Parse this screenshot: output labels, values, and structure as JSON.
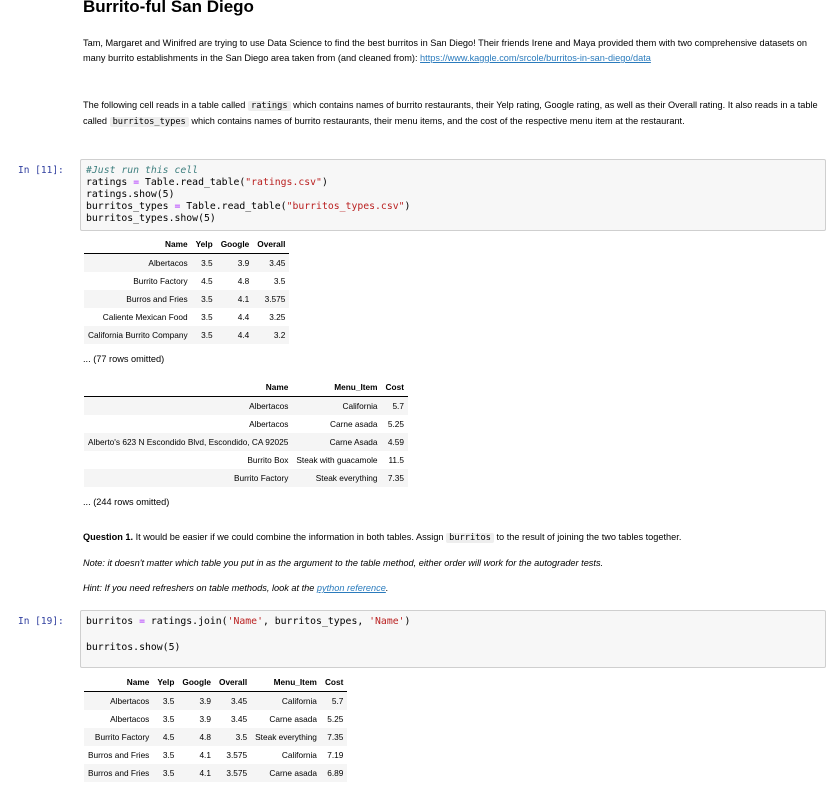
{
  "title": "Burrito-ful San Diego",
  "intro": {
    "text": "Tam, Margaret and Winifred are trying to use Data Science to find the best burritos in San Diego! Their friends Irene and Maya provided them with two comprehensive datasets on many burrito establishments in the San Diego area taken from (and cleaned from): ",
    "link": "https://www.kaggle.com/srcole/burritos-in-san-diego/data"
  },
  "para2": {
    "t1": "The following cell reads in a table called ",
    "c1": "ratings",
    "t2": " which contains names of burrito restaurants, their Yelp rating, Google rating, as well as their Overall rating. It also reads in a table called ",
    "c2": "burritos_types",
    "t3": " which contains names of burrito restaurants, their menu items, and the cost of the respective menu item at the restaurant."
  },
  "cell1": {
    "prompt": "In [11]:",
    "comment": "#Just run this cell",
    "l2a": "ratings ",
    "l2b": " Table.read_table(",
    "l2s": "\"ratings.csv\"",
    "l2c": ")",
    "l3": "ratings.show(5)",
    "l4a": "burritos_types ",
    "l4b": " Table.read_table(",
    "l4s": "\"burritos_types.csv\"",
    "l4c": ")",
    "l5": "burritos_types.show(5)"
  },
  "ratings_table": {
    "headers": [
      "Name",
      "Yelp",
      "Google",
      "Overall"
    ],
    "rows": [
      [
        "Albertacos",
        "3.5",
        "3.9",
        "3.45"
      ],
      [
        "Burrito Factory",
        "4.5",
        "4.8",
        "3.5"
      ],
      [
        "Burros and Fries",
        "3.5",
        "4.1",
        "3.575"
      ],
      [
        "Caliente Mexican Food",
        "3.5",
        "4.4",
        "3.25"
      ],
      [
        "California Burrito Company",
        "3.5",
        "4.4",
        "3.2"
      ]
    ],
    "omitted": "... (77 rows omitted)"
  },
  "types_table": {
    "headers": [
      "Name",
      "Menu_Item",
      "Cost"
    ],
    "rows": [
      [
        "Albertacos",
        "California",
        "5.7"
      ],
      [
        "Albertacos",
        "Carne asada",
        "5.25"
      ],
      [
        "Alberto's 623 N Escondido Blvd, Escondido, CA 92025",
        "Carne Asada",
        "4.59"
      ],
      [
        "Burrito Box",
        "Steak with guacamole",
        "11.5"
      ],
      [
        "Burrito Factory",
        "Steak everything",
        "7.35"
      ]
    ],
    "omitted": "... (244 rows omitted)"
  },
  "question": {
    "label": "Question 1.",
    "t1": " It would be easier if we could combine the information in both tables. Assign ",
    "code": "burritos",
    "t2": " to the result of joining the two tables together.",
    "note": "Note: it doesn't matter which table you put in as the argument to the table method, either order will work for the autograder tests.",
    "hint_text": "Hint: If you need refreshers on table methods, look at the ",
    "hint_link": "python reference",
    "hint_end": "."
  },
  "cell2": {
    "prompt": "In [19]:",
    "l1a": "burritos ",
    "l1b": " ratings.join(",
    "l1s1": "'Name'",
    "l1m": ", burritos_types, ",
    "l1s2": "'Name'",
    "l1c": ")",
    "l2": "burritos.show(5)"
  },
  "joined_table": {
    "headers": [
      "Name",
      "Yelp",
      "Google",
      "Overall",
      "Menu_Item",
      "Cost"
    ],
    "rows": [
      [
        "Albertacos",
        "3.5",
        "3.9",
        "3.45",
        "California",
        "5.7"
      ],
      [
        "Albertacos",
        "3.5",
        "3.9",
        "3.45",
        "Carne asada",
        "5.25"
      ],
      [
        "Burrito Factory",
        "4.5",
        "4.8",
        "3.5",
        "Steak everything",
        "7.35"
      ],
      [
        "Burros and Fries",
        "3.5",
        "4.1",
        "3.575",
        "California",
        "7.19"
      ],
      [
        "Burros and Fries",
        "3.5",
        "4.1",
        "3.575",
        "Carne asada",
        "6.89"
      ]
    ]
  },
  "colors": {
    "prompt": "#303f9f",
    "string": "#ba2121",
    "comment": "#408080",
    "link": "#2a7bbd",
    "cell_bg": "#f7f7f7"
  }
}
